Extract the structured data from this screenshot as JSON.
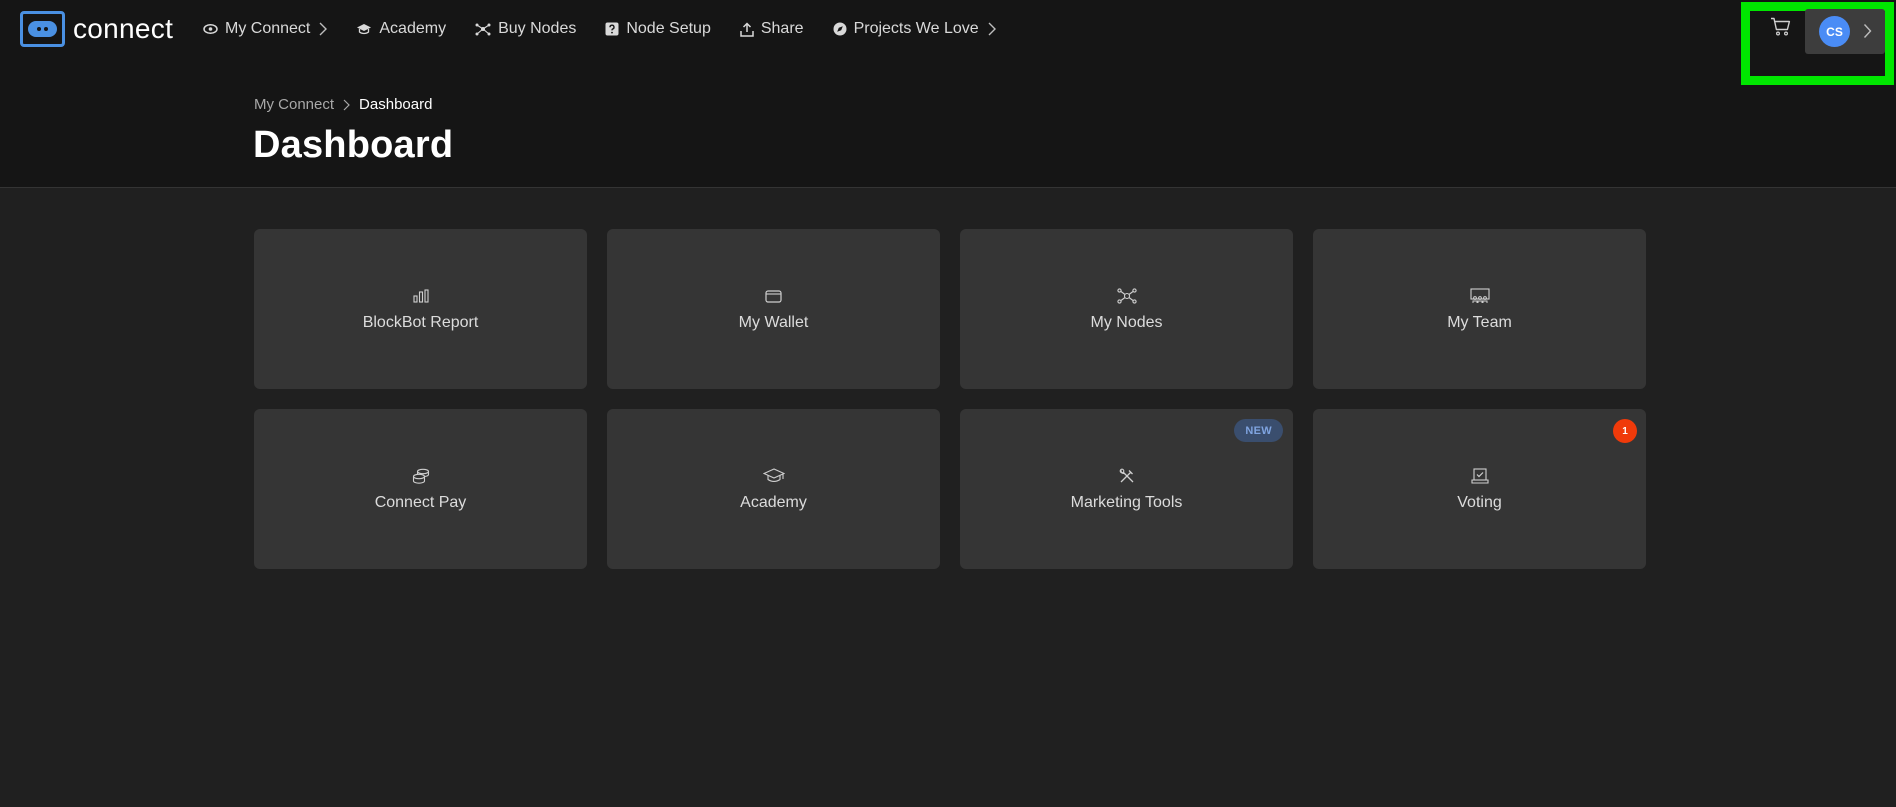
{
  "app": {
    "logo_text": "connect"
  },
  "nav": {
    "items": [
      {
        "label": "My Connect",
        "icon": "eye-icon",
        "has_chevron": true
      },
      {
        "label": "Academy",
        "icon": "graduation-cap-icon"
      },
      {
        "label": "Buy Nodes",
        "icon": "nodes-icon"
      },
      {
        "label": "Node Setup",
        "icon": "help-box-icon"
      },
      {
        "label": "Share",
        "icon": "share-upload-icon"
      },
      {
        "label": "Projects We Love",
        "icon": "compass-icon",
        "has_chevron": true
      }
    ]
  },
  "user": {
    "initials": "CS",
    "avatar_color": "#4a8cf5"
  },
  "breadcrumb": {
    "parent": "My Connect",
    "current": "Dashboard"
  },
  "page": {
    "title": "Dashboard"
  },
  "cards": [
    {
      "label": "BlockBot Report",
      "icon": "bar-chart-icon"
    },
    {
      "label": "My Wallet",
      "icon": "wallet-icon"
    },
    {
      "label": "My Nodes",
      "icon": "network-nodes-icon"
    },
    {
      "label": "My Team",
      "icon": "team-board-icon"
    },
    {
      "label": "Connect Pay",
      "icon": "coins-stack-icon"
    },
    {
      "label": "Academy",
      "icon": "graduation-cap-icon"
    },
    {
      "label": "Marketing Tools",
      "icon": "tools-icon",
      "badge": "NEW"
    },
    {
      "label": "Voting",
      "icon": "ballot-box-icon",
      "count": "1"
    }
  ],
  "colors": {
    "accent": "#4a90e2",
    "highlight": "#00e600",
    "badge_new_bg": "#3a4e6e",
    "badge_count_bg": "#f03a0a"
  }
}
